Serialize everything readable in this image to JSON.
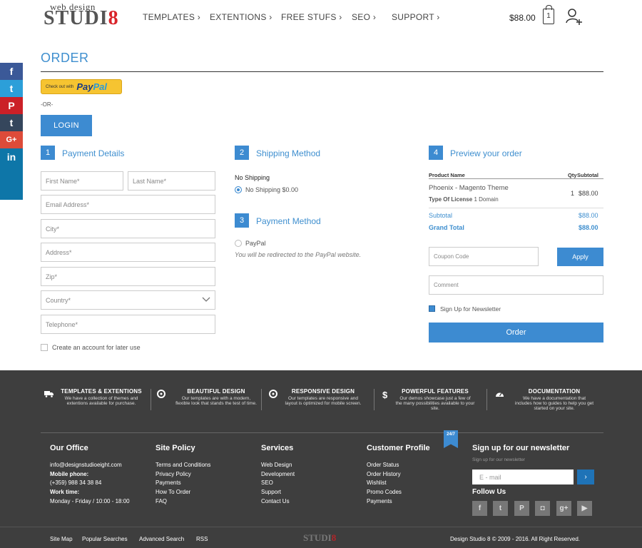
{
  "header": {
    "logo_top": "web design",
    "logo_main": "STUDI",
    "logo_eight": "8",
    "nav": [
      "TEMPLATES ›",
      "EXTENTIONS ›",
      "FREE STUFS ›",
      "SEO ›",
      "SUPPORT ›"
    ],
    "cart_total": "$88.00",
    "cart_count": "1"
  },
  "social": [
    {
      "icon": "facebook-icon",
      "glyph": "f",
      "color": "#3b5998"
    },
    {
      "icon": "twitter-icon",
      "glyph": "t",
      "color": "#2c9fd9"
    },
    {
      "icon": "pinterest-icon",
      "glyph": "P",
      "color": "#cb2027"
    },
    {
      "icon": "tumblr-icon",
      "glyph": "t",
      "color": "#35465c"
    },
    {
      "icon": "googleplus-icon",
      "glyph": "G+",
      "color": "#dd4b39"
    },
    {
      "icon": "linkedin-icon",
      "glyph": "in",
      "color": "#0e76a8"
    }
  ],
  "order": {
    "title": "ORDER",
    "paypal_small": "Check out with",
    "paypal_pay": "Pay",
    "paypal_pal": "Pal",
    "or": "-OR-",
    "login": "LOGIN"
  },
  "payment_details": {
    "num": "1",
    "title": "Payment Details",
    "first_name": "First Name*",
    "last_name": "Last Name*",
    "email": "Email Address*",
    "city": "City*",
    "address": "Address*",
    "zip": "Zip*",
    "country": "Country*",
    "telephone": "Telephone*",
    "create_account": "Create an account for later use"
  },
  "shipping": {
    "num": "2",
    "title": "Shipping Method",
    "label": "No Shipping",
    "option": "No Shipping $0.00"
  },
  "payment_method": {
    "num": "3",
    "title": "Payment Method",
    "option": "PayPal",
    "note": "You will be redirected to the PayPal website."
  },
  "preview": {
    "num": "4",
    "title": "Preview your order",
    "col_product": "Product Name",
    "col_qty": "Qty",
    "col_subtotal": "Subtotal",
    "product": "Phoenix - Magento Theme",
    "license_label": "Type Of License",
    "license_value": "1 Domain",
    "qty": "1",
    "price": "$88.00",
    "subtotal_label": "Subtotal",
    "subtotal_value": "$88.00",
    "grand_label": "Grand Total",
    "grand_value": "$88.00",
    "coupon_placeholder": "Coupon Code",
    "apply": "Apply",
    "comment_placeholder": "Comment",
    "newsletter": "Sign Up for Newsletter",
    "order_btn": "Order"
  },
  "features": [
    {
      "icon": "truck-icon",
      "title": "TEMPLATES & EXTENTIONS",
      "desc1": "We have a collection of themes and",
      "desc2": "extentions available for purchase.",
      "desc3": ""
    },
    {
      "icon": "lifebuoy-icon",
      "title": "BEAUTIFUL DESIGN",
      "desc1": "Our templates are with a modern,",
      "desc2": "flexible look that stands the test of time.",
      "desc3": ""
    },
    {
      "icon": "lifebuoy-icon",
      "title": "RESPONSIVE DESIGN",
      "desc1": "Our templates are responsive and",
      "desc2": "layout is optimized for mobile screen.",
      "desc3": ""
    },
    {
      "icon": "dollar-icon",
      "title": "POWERFUL FEATURES",
      "desc1": "Our demos showcase just a few of",
      "desc2": "the many possibilities available to your",
      "desc3": "site."
    },
    {
      "icon": "dashboard-icon",
      "title": "DOCUMENTATION",
      "desc1": "We have a documentation that",
      "desc2": "includes how to guides to help you get",
      "desc3": "started on your site."
    }
  ],
  "footer": {
    "office_title": "Our Office",
    "office_email": "info@designstudioeight.com",
    "mobile_label": "Mobile phone:",
    "mobile_value": "(+359) 988 34 38 84",
    "work_label": "Work time:",
    "work_value": "Monday - Friday / 10:00 - 18:00",
    "policy_title": "Site Policy",
    "policy_links": [
      "Terms and Conditions",
      "Privacy Policy",
      "Payments",
      "How To Order",
      "FAQ"
    ],
    "services_title": "Services",
    "services_links": [
      "Web Design",
      "Development",
      "SEO",
      "Support",
      "Contact Us"
    ],
    "profile_title": "Customer Profile",
    "profile_links": [
      "Order Status",
      "Order History",
      "Wishlist",
      "Promo Codes",
      "Payments"
    ],
    "badge": "24/7",
    "newsletter_title": "Sign up for our newsletter",
    "newsletter_sub": "Sign up for our newsletter",
    "email_placeholder": "E - mail",
    "email_btn": "›",
    "follow": "Follow Us",
    "follow_icons": [
      {
        "icon": "facebook-icon",
        "glyph": "f"
      },
      {
        "icon": "twitter-icon",
        "glyph": "t"
      },
      {
        "icon": "pinterest-icon",
        "glyph": "P"
      },
      {
        "icon": "instagram-icon",
        "glyph": "◘"
      },
      {
        "icon": "googleplus-icon",
        "glyph": "g+"
      },
      {
        "icon": "youtube-icon",
        "glyph": "▶"
      }
    ],
    "bottom_links": [
      "Site Map",
      "Popular Searches",
      "Advanced Search",
      "RSS"
    ],
    "footer_logo": "STUDI",
    "footer_logo_eight": "8",
    "copyright": "Design Studio 8 © 2009 - 2016. All Right Reserved."
  }
}
